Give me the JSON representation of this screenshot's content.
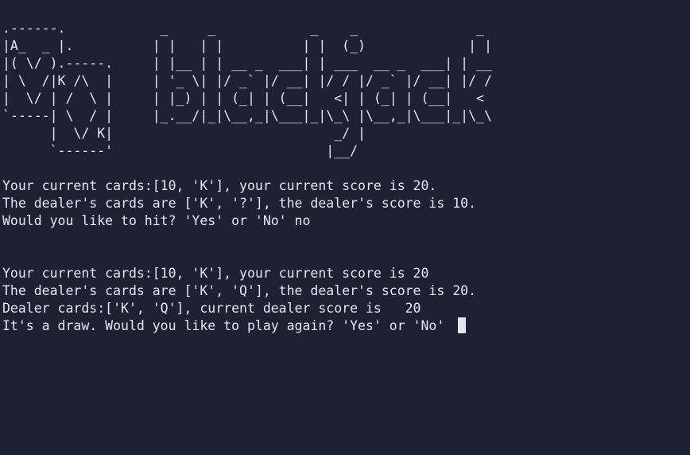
{
  "art": {
    "lines": [
      ".------.            _     _            _    _               _",
      "|A_  _ |.          | |   | |          | |  (_)             | |",
      "|( \\/ ).-----.     | |__ | | __ _  ___| | ___  __ _  ___| | __",
      "| \\  /|K /\\  |     | '_ \\| |/ _` |/ __| |/ / |/ _` |/ __| |/ /",
      "|  \\/ | /  \\ |     | |_) | | (_| | (__|   <| | (_| | (__|   <",
      "`-----| \\  / |     |_.__/|_|\\__,_|\\___|_|\\_\\ |\\__,_|\\___|_|\\_\\",
      "      |  \\/ K|                            _/ |",
      "      `------'                           |__/"
    ]
  },
  "round1": {
    "player_line": "Your current cards:[10, 'K'], your current score is 20.",
    "dealer_line": "The dealer's cards are ['K', '?'], the dealer's score is 10.",
    "hit_prompt": "Would you like to hit? 'Yes' or 'No' no"
  },
  "round2": {
    "player_line": "Your current cards:[10, 'K'], your current score is 20",
    "dealer_line": "The dealer's cards are ['K', 'Q'], the dealer's score is 20.",
    "dealer_final": "Dealer cards:['K', 'Q'], current dealer score is   20",
    "result_prompt": "It's a draw. Would you like to play again? 'Yes' or 'No' "
  }
}
